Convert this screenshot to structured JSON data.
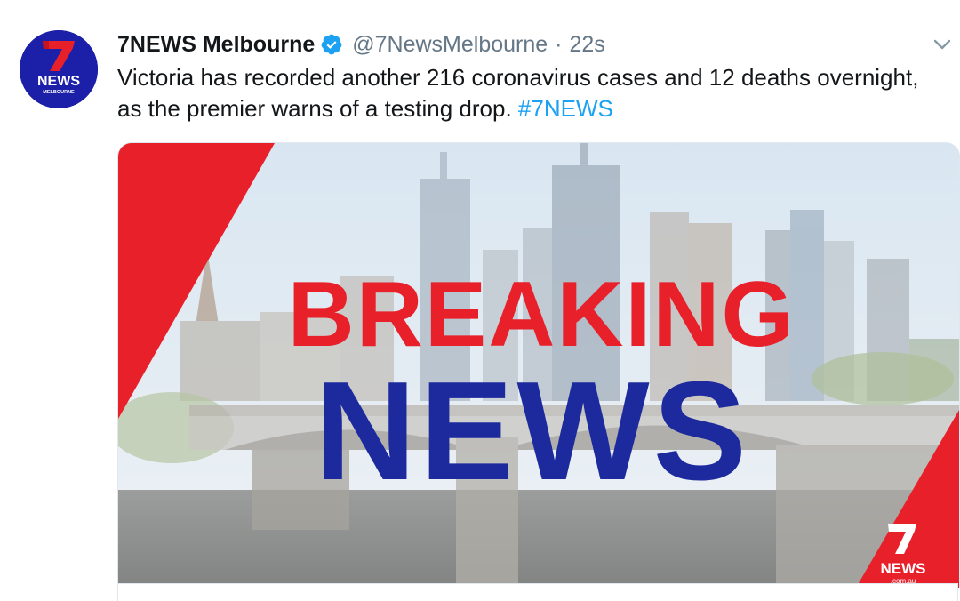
{
  "tweet": {
    "display_name": "7NEWS Melbourne",
    "handle": "@7NewsMelbourne",
    "separator": "·",
    "time": "22s",
    "text": "Victoria has recorded another 216 coronavirus cases and 12 deaths overnight, as the premier warns of a testing drop.",
    "hashtag": "#7NEWS"
  },
  "avatar": {
    "logo_number": "7",
    "logo_text": "NEWS",
    "logo_subtext": "MELBOURNE"
  },
  "media": {
    "headline_top": "BREAKING",
    "headline_bottom": "NEWS",
    "watermark_number": "7",
    "watermark_text": "NEWS",
    "watermark_sub": ".com.au"
  },
  "icons": {
    "verified": "verified-badge-icon",
    "caret": "chevron-down-icon"
  },
  "colors": {
    "brand_blue": "#1c1fa8",
    "breaking_red": "#e8202a",
    "news_blue": "#1d2a9e",
    "verified_blue": "#1da1f2",
    "hashtag_blue": "#1da1f2",
    "muted_text": "#657786"
  }
}
